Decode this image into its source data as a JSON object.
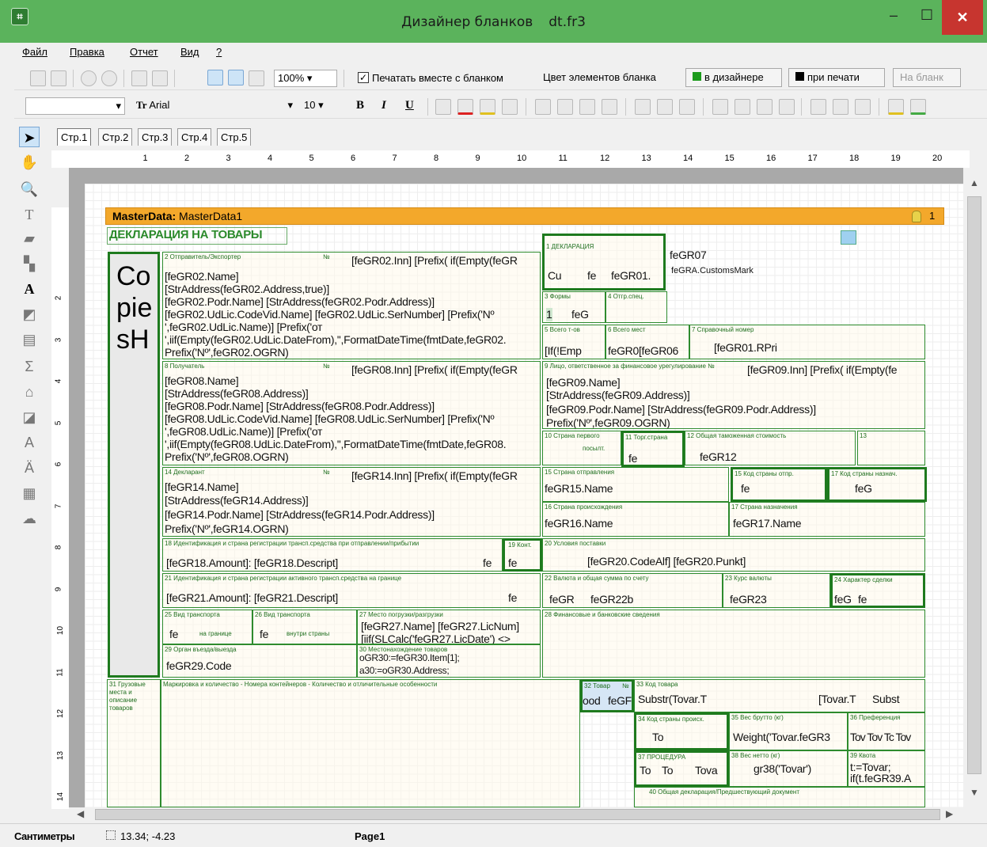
{
  "window": {
    "title_app": "Дизайнер бланков",
    "title_file": "dt.fr3",
    "icon": "app-grid-icon",
    "minimize": "–",
    "maximize": "☐",
    "close": "✕"
  },
  "menu": [
    {
      "label": "Файл"
    },
    {
      "label": "Правка"
    },
    {
      "label": "Отчет"
    },
    {
      "label": "Вид"
    },
    {
      "label": "?"
    }
  ],
  "toolbar1": {
    "zoom": "100%",
    "print_with_form": "Печатать вместе с бланком",
    "element_color_label": "Цвет элементов бланка",
    "in_designer": "в дизайнере",
    "on_print": "при печати",
    "to_form": "На бланк"
  },
  "toolbar2": {
    "font_name": "Arial",
    "font_size": "10",
    "bold": "B",
    "italic": "I",
    "underline": "U"
  },
  "tabs": [
    "Стр.1",
    "Стр.2",
    "Стр.3",
    "Стр.4",
    "Стр.5"
  ],
  "ruler_top": [
    "1",
    "2",
    "3",
    "4",
    "5",
    "6",
    "7",
    "8",
    "9",
    "10",
    "11",
    "12",
    "13",
    "14",
    "15",
    "16",
    "17",
    "18",
    "19",
    "20"
  ],
  "ruler_left": [
    "2",
    "3",
    "4",
    "5",
    "6",
    "7",
    "8",
    "9",
    "10",
    "11",
    "12",
    "13",
    "14"
  ],
  "band": {
    "title_bold": "MasterData:",
    "title": "MasterData1",
    "count": "1"
  },
  "form": {
    "heading": "ДЕКЛАРАЦИЯ НА ТОВАРЫ",
    "copies": "Co pie sH",
    "b2_label": "2 Отправитель/Экспортер",
    "b2_no": "№",
    "b2_inn": "[feGR02.Inn] [Prefix( if(Empty(feGR",
    "b2_lines": [
      "[feGR02.Name]",
      "[StrAddress(feGR02.Address,true)]",
      "[feGR02.Podr.Name] [StrAddress(feGR02.Podr.Address)]",
      "[feGR02.UdLic.CodeVid.Name] [feGR02.UdLic.SerNumber] [Prefix('Nº",
      "',feGR02.UdLic.Name)] [Prefix('от",
      "',iif(Empty(feGR02.UdLic.DateFrom),'',FormatDateTime(fmtDate,feGR02.",
      "Prefix('Nº',feGR02.OGRN)"
    ],
    "b1_label": "1 ДЕКЛАРАЦИЯ",
    "b1_v1": "Cu",
    "b1_v2": "fe",
    "b1_v3": "feGR01.",
    "b07": "feGR07",
    "b07_mark": "feGRA.CustomsMark",
    "b3_label": "3 Формы",
    "b3_v1": "1",
    "b3_v2": "feG",
    "b4_label": "4 Отгр.спец.",
    "b5_label": "5 Всего т-ов",
    "b5_v": "[If(!Emp",
    "b6_label": "6 Всего мест",
    "b6_v": "feGR0[feGR06",
    "b7_label": "7 Справочный номер",
    "b7_v": "[feGR01.RPri",
    "b8_label": "8 Получатель",
    "b8_no": "№",
    "b8_inn": "[feGR08.Inn] [Prefix( if(Empty(feGR",
    "b8_lines": [
      "[feGR08.Name]",
      "[StrAddress(feGR08.Address)]",
      "[feGR08.Podr.Name] [StrAddress(feGR08.Podr.Address)]",
      "[feGR08.UdLic.CodeVid.Name] [feGR08.UdLic.SerNumber] [Prefix('Nº",
      "',feGR08.UdLic.Name)] [Prefix('от",
      "',iif(Empty(feGR08.UdLic.DateFrom),'',FormatDateTime(fmtDate,feGR08.",
      "Prefix('Nº',feGR08.OGRN)"
    ],
    "b9_label": "9 Лицо, ответственное за финансовое урегулирование №",
    "b9_inn": "[feGR09.Inn] [Prefix( if(Empty(fe",
    "b9_lines": [
      "[feGR09.Name]",
      "[StrAddress(feGR09.Address)]",
      "[feGR09.Podr.Name] [StrAddress(feGR09.Podr.Address)]",
      "Prefix('Nº',feGR09.OGRN)"
    ],
    "b10_label": "10 Страна первого",
    "b10_sub": "посылт.",
    "b11_label": "11 Торг.страна",
    "b11_v": "fe",
    "b12_label": "12 Общая таможенная стоимость",
    "b12_v": "feGR12",
    "b13_label": "13",
    "b14_label": "14 Декларант",
    "b14_no": "№",
    "b14_inn": "[feGR14.Inn] [Prefix( if(Empty(feGR",
    "b14_lines": [
      "[feGR14.Name]",
      "[StrAddress(feGR14.Address)]",
      "[feGR14.Podr.Name] [StrAddress(feGR14.Podr.Address)]",
      "Prefix('Nº',feGR14.OGRN)"
    ],
    "b15_label": "15 Страна отправления",
    "b15_v": "feGR15.Name",
    "b15a_label": "15 Код страны отпр.",
    "b15a_v": "fe",
    "b17a_label": "17 Код страны назнач.",
    "b17a_v": "feG",
    "b16_label": "16 Страна происхождения",
    "b16_v": "feGR16.Name",
    "b17_label": "17 Страна назначения",
    "b17_v": "feGR17.Name",
    "b18_label": "18 Идентификация и страна регистрации трансп.средства при отправлении/прибытии",
    "b18_v": "[feGR18.Amount]: [feGR18.Descript]",
    "b18_v2": "fe",
    "b18_v3": "fe",
    "b19_label": "19 Конт.",
    "b20_label": "20 Условия поставки",
    "b20_v": "[feGR20.CodeAlf]  [feGR20.Punkt]",
    "b21_label": "21 Идентификация и страна регистрации активного трансп.средства на границе",
    "b21_v": "[feGR21.Amount]: [feGR21.Descript]",
    "b21_v2": "fe",
    "b22_label": "22 Валюта и общая сумма по счету",
    "b22_v1": "feGR",
    "b22_v2": "feGR22b",
    "b23_label": "23 Курс валюты",
    "b23_v": "feGR23",
    "b24_label": "24 Характер сделки",
    "b24_v1": "feG",
    "b24_v2": "fe",
    "b25_label": "25 Вид транспорта",
    "b25_v": "fe",
    "b25_sub": "на границе",
    "b26_label": "26 Вид транспорта",
    "b26_v": "fe",
    "b26_sub": "внутри страны",
    "b27_label": "27 Место погрузки/разгрузки",
    "b27_lines": [
      "[feGR27.Name] [feGR27.LicNum]",
      "[iif(SLCalc('feGR27.LicDate') <>"
    ],
    "b28_label": "28 Финансовые и банковские сведения",
    "b29_label": "29 Орган въезда/выезда",
    "b29_v": "feGR29.Code",
    "b30_label": "30 Местонахождение товаров",
    "b30_lines": [
      "oGR30:=feGR30.Item[1];",
      "a30:=oGR30.Address;"
    ],
    "b31_label_lines": [
      "31 Грузовые",
      "места и",
      "описание",
      "товаров"
    ],
    "b31_desc": "Маркировка и количество - Номера контейнеров - Количество и отличительные особенности",
    "b32_label": "32 Товар",
    "b32_no": "№",
    "b33_label": "33 Код товара",
    "b32_v1": "ood",
    "b32_v2": "feGF",
    "b33_v1": "Substr(Tovar.T",
    "b33_v2": "[Tovar.T",
    "b33_v3": "Subst",
    "b34_label": "34 Код страны происх.",
    "b34_v": "To",
    "b35_label": "35 Вес брутто (кг)",
    "b35_v": "Weight('Tovar.feGR3",
    "b36_label": "36 Преференция",
    "b36_v": "Tov Tov Tc Tov",
    "b37_label": "37 ПРОЦЕДУРА",
    "b37_v1": "To",
    "b37_v2": "To",
    "b37_v3": "Tova",
    "b38_label": "38 Вес нетто (кг)",
    "b38_v": "gr38('Tovar')",
    "b39_label": "39 Квота",
    "b39_lines": [
      "t:=Tovar;",
      "if(t.feGR39.A"
    ],
    "b40_label": "40 Общая декларация/Предшествующий документ"
  },
  "status": {
    "units": "Сантиметры",
    "coords": "13.34; -4.23",
    "page": "Page1"
  }
}
